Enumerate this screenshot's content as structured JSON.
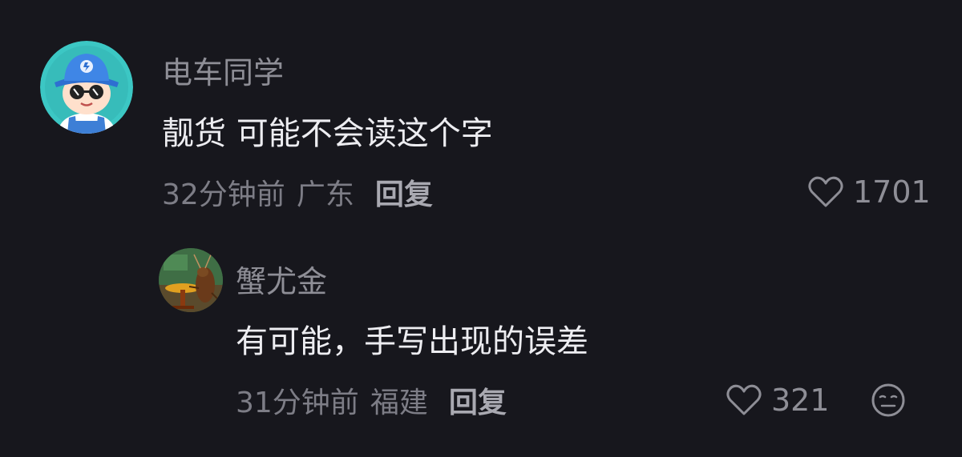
{
  "comments": [
    {
      "username": "电车同学",
      "text": "靓货 可能不会读这个字",
      "time": "32分钟前",
      "location": "广东",
      "reply_label": "回复",
      "likes": "1701",
      "avatar": "cartoon-boy-blue-hat-sunglasses"
    },
    {
      "username": "蟹尤金",
      "text": "有可能，手写出现的误差",
      "time": "31分钟前",
      "location": "福建",
      "reply_label": "回复",
      "likes": "321",
      "avatar": "cartoon-cockroach-at-table"
    }
  ],
  "icons": {
    "like": "heart-outline-icon",
    "dislike": "meh-face-icon"
  },
  "colors": {
    "background": "#17171d",
    "text": "#ededf1",
    "muted": "#7d7d86"
  }
}
